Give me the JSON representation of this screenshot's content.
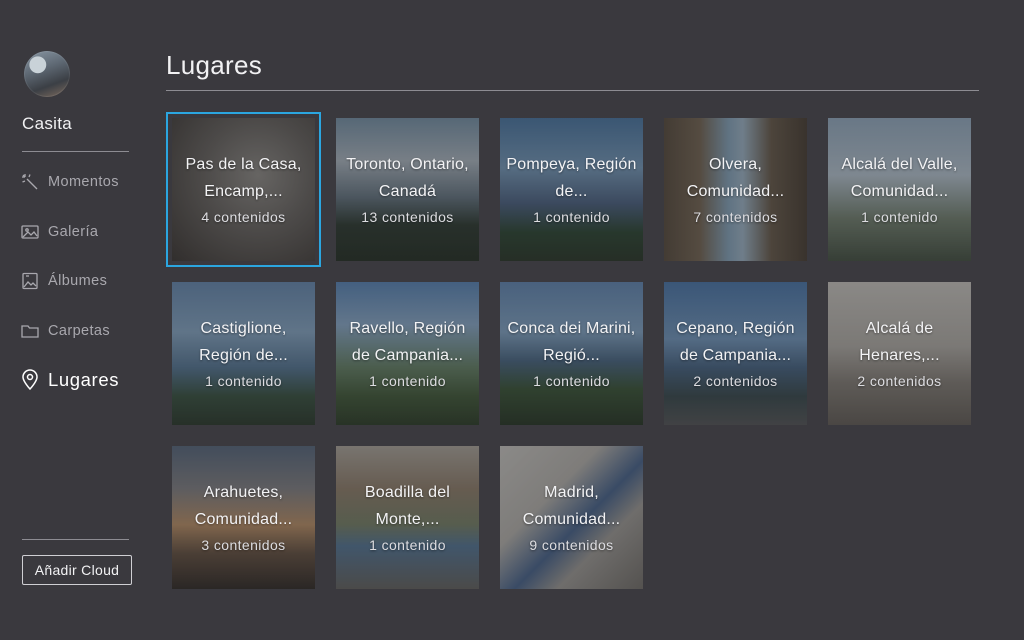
{
  "sidebar": {
    "account_name": "Casita",
    "items": [
      {
        "label": "Momentos",
        "icon": "magic-wand-icon"
      },
      {
        "label": "Galería",
        "icon": "image-icon"
      },
      {
        "label": "Álbumes",
        "icon": "album-icon"
      },
      {
        "label": "Carpetas",
        "icon": "folder-icon"
      },
      {
        "label": "Lugares",
        "icon": "location-pin-icon",
        "active": true
      }
    ],
    "add_cloud_label": "Añadir Cloud"
  },
  "main": {
    "title": "Lugares",
    "selection_color": "#2ba6e0",
    "places": [
      {
        "name": "Pas de la Casa, Encamp,...",
        "count": "4 contenidos",
        "selected": true
      },
      {
        "name": "Toronto, Ontario, Canadá",
        "count": "13 contenidos"
      },
      {
        "name": "Pompeya, Región de...",
        "count": "1 contenido"
      },
      {
        "name": "Olvera, Comunidad...",
        "count": "7 contenidos"
      },
      {
        "name": "Alcalá del Valle, Comunidad...",
        "count": "1 contenido"
      },
      {
        "name": "Castiglione, Región de...",
        "count": "1 contenido"
      },
      {
        "name": "Ravello, Región de Campania...",
        "count": "1 contenido"
      },
      {
        "name": "Conca dei Marini, Regió...",
        "count": "1 contenido"
      },
      {
        "name": "Cepano, Región de Campania...",
        "count": "2 contenidos"
      },
      {
        "name": "Alcalá de Henares,...",
        "count": "2 contenidos"
      },
      {
        "name": "Arahuetes, Comunidad...",
        "count": "3 contenidos"
      },
      {
        "name": "Boadilla del Monte,...",
        "count": "1 contenido"
      },
      {
        "name": "Madrid, Comunidad...",
        "count": "9 contenidos"
      }
    ]
  }
}
